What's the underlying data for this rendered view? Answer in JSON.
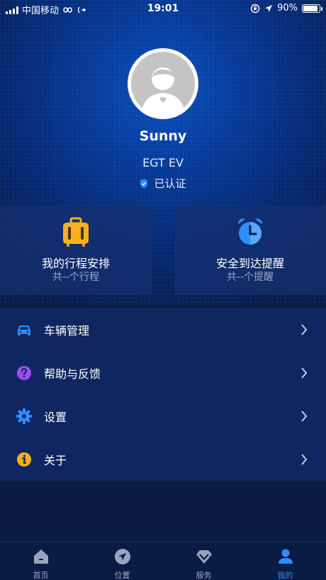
{
  "status_bar": {
    "carrier": "中国移动",
    "time": "19:01",
    "battery": "90%",
    "battery_level": 0.9
  },
  "profile": {
    "username": "Sunny",
    "car": "EGT EV",
    "verified_label": "已认证"
  },
  "cards": [
    {
      "title": "我的行程安排",
      "subtitle": "共--个行程",
      "icon": "suitcase-icon",
      "color": "#f5b21e"
    },
    {
      "title": "安全到达提醒",
      "subtitle": "共--个提醒",
      "icon": "alarm-clock-icon",
      "color": "#2f8dff"
    }
  ],
  "menu": [
    {
      "label": "车辆管理",
      "icon": "car-icon",
      "color": "#2f8dff"
    },
    {
      "label": "帮助与反馈",
      "icon": "help-icon",
      "color": "#a24cf0"
    },
    {
      "label": "设置",
      "icon": "gear-icon",
      "color": "#2f8dff"
    },
    {
      "label": "关于",
      "icon": "info-icon",
      "color": "#f5b21e"
    }
  ],
  "tabs": [
    {
      "label": "首页",
      "icon": "home-icon",
      "active": false
    },
    {
      "label": "位置",
      "icon": "location-icon",
      "active": false
    },
    {
      "label": "服务",
      "icon": "service-diamond-icon",
      "active": false
    },
    {
      "label": "我的",
      "icon": "profile-icon",
      "active": true
    }
  ],
  "colors": {
    "accent": "#2f8dff",
    "background": "#0b1b42",
    "menu_bg": "#0f2660"
  }
}
